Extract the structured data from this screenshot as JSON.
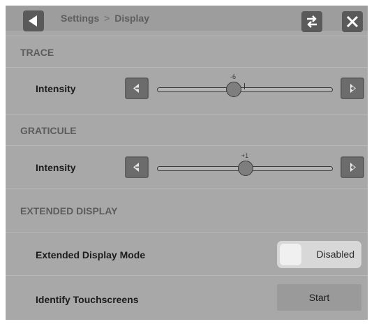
{
  "header": {
    "breadcrumb_parent": "Settings",
    "breadcrumb_separator": ">",
    "breadcrumb_current": "Display",
    "icons": {
      "back": "back-arrow-icon",
      "swap": "swap-arrows-icon",
      "close": "close-x-icon"
    }
  },
  "trace": {
    "title": "TRACE",
    "intensity_label": "Intensity",
    "intensity_value": "-6"
  },
  "graticule": {
    "title": "GRATICULE",
    "intensity_label": "Intensity",
    "intensity_value": "+1"
  },
  "extended_display": {
    "title": "EXTENDED DISPLAY",
    "mode_label": "Extended Display Mode",
    "mode_value": "Disabled",
    "identify_label": "Identify Touchscreens",
    "identify_button": "Start"
  },
  "colors": {
    "panel": "#a8a8a8",
    "button": "#5a5a5a",
    "toggle": "#d8d8d8"
  }
}
